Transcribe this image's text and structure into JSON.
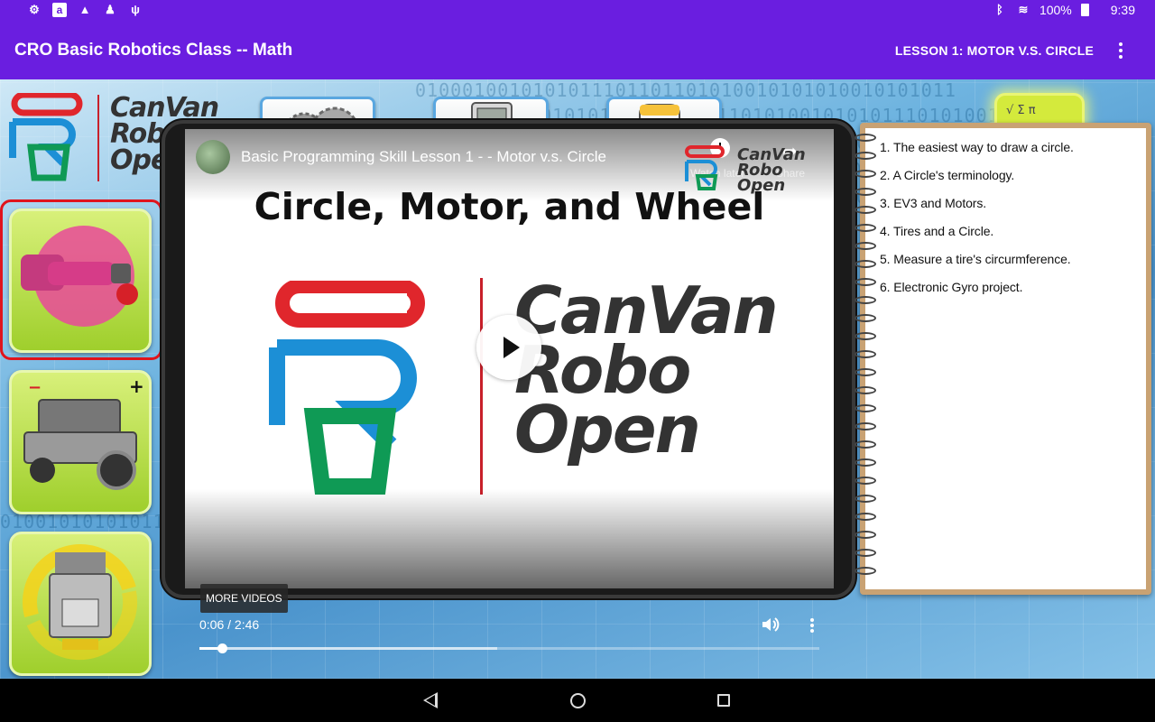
{
  "status_bar": {
    "battery": "100%",
    "time": "9:39",
    "icons": [
      "gear-icon",
      "amazon-icon",
      "warning-icon",
      "android-icon",
      "usb-icon",
      "bluetooth-icon",
      "wifi-icon",
      "battery-icon"
    ]
  },
  "app_bar": {
    "title": "CRO Basic Robotics Class -- Math",
    "lesson": "LESSON 1: MOTOR V.S. CIRCLE"
  },
  "logo": {
    "line1": "CanVan",
    "line2": "Robo",
    "line3": "Open"
  },
  "toolbar": {
    "tiles": [
      "gears-tile",
      "ev3-brick-tile",
      "program-block-tile",
      "formula-tile"
    ]
  },
  "side_buttons": [
    "motor-button",
    "robot-speed-button",
    "robot-turn-button"
  ],
  "video": {
    "title": "Basic Programming Skill Lesson 1 - - Motor v.s. Circle",
    "watch_later": "Watch later",
    "share": "Share",
    "headline": "Circle, Motor, and Wheel",
    "big_logo_line1": "CanVan",
    "big_logo_line2": "Robo",
    "big_logo_line3": "Open",
    "corner_logo_line1": "CanVan",
    "corner_logo_line2": "Robo",
    "corner_logo_line3": "Open",
    "more_videos": "MORE VIDEOS",
    "timecode": "0:06 / 2:46",
    "current_seconds": 6,
    "duration_seconds": 166,
    "buffered_fraction": 0.48
  },
  "topics": [
    "1. The easiest way to draw a circle.",
    "2. A Circle's terminology.",
    "3. EV3 and Motors.",
    "4. Tires and a Circle.",
    "5. Measure a tire's circurmference.",
    "6. Electronic Gyro project."
  ],
  "colors": {
    "app_bar": "#6a1ee0",
    "logo_red": "#e0262c",
    "logo_blue": "#1c8fd6",
    "logo_green": "#0f9a55",
    "side_button_green": "#b5dc44",
    "selected_border": "#e0141c",
    "notebook_cover": "#c9a273"
  }
}
